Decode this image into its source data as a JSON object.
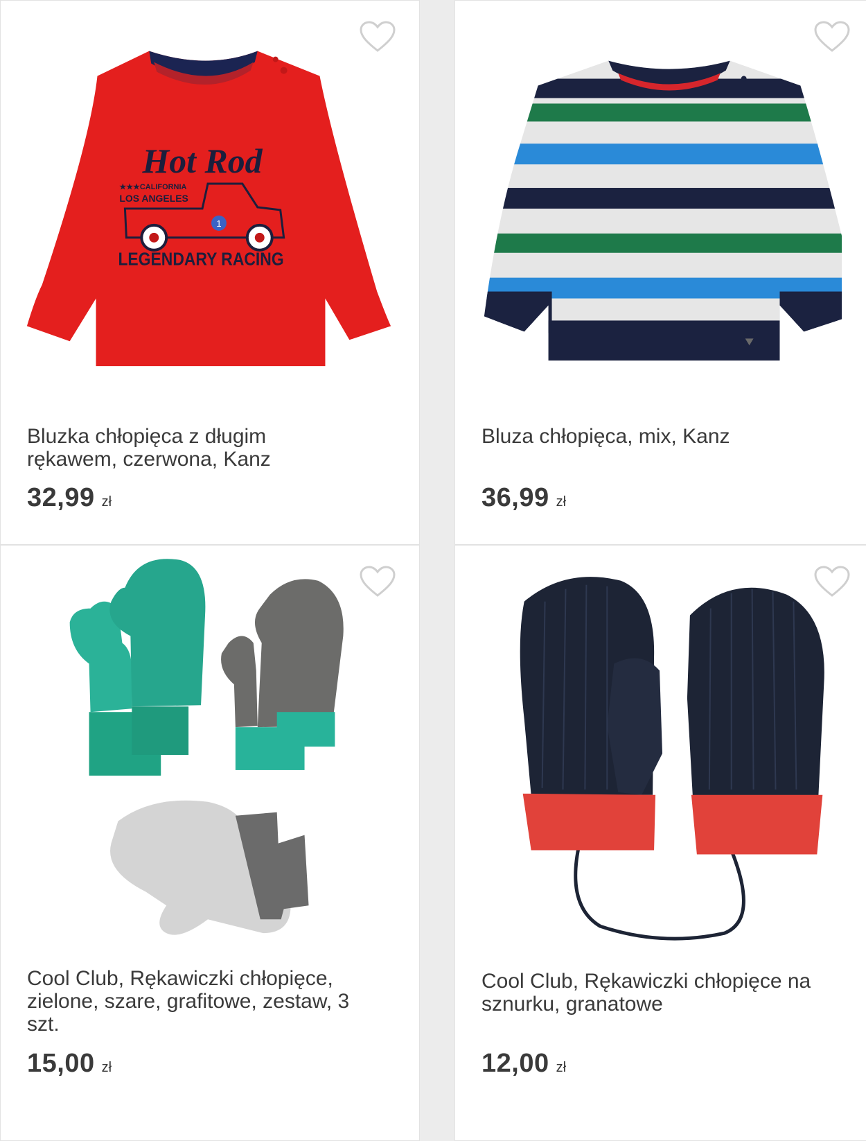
{
  "products": [
    {
      "title": "Bluzka chłopięca z długim\nrękawem, czerwona, Kanz",
      "price": "32,99",
      "currency": "zł",
      "image_icon": "red-long-sleeve-shirt-image",
      "favorite_icon": "heart-outline-icon",
      "print_text": [
        "Hot Rod",
        "CALIFORNIA",
        "LOS ANGELES",
        "LEGENDARY RACING",
        "1"
      ]
    },
    {
      "title": "Bluza chłopięca, mix, Kanz",
      "price": "36,99",
      "currency": "zł",
      "image_icon": "striped-sweatshirt-image",
      "favorite_icon": "heart-outline-icon"
    },
    {
      "title": "Cool Club, Rękawiczki chłopięce,\nzielone, szare, grafitowe, zestaw, 3\nszt.",
      "price": "15,00",
      "currency": "zł",
      "image_icon": "three-pairs-mittens-image",
      "favorite_icon": "heart-outline-icon"
    },
    {
      "title": "Cool Club, Rękawiczki chłopięce na\nsznurku, granatowe",
      "price": "12,00",
      "currency": "zł",
      "image_icon": "navy-mittens-on-string-image",
      "favorite_icon": "heart-outline-icon"
    }
  ],
  "colors": {
    "text": "#3a3a3a",
    "background": "#ececec",
    "card": "#ffffff",
    "heart": "#cfcfcf"
  }
}
